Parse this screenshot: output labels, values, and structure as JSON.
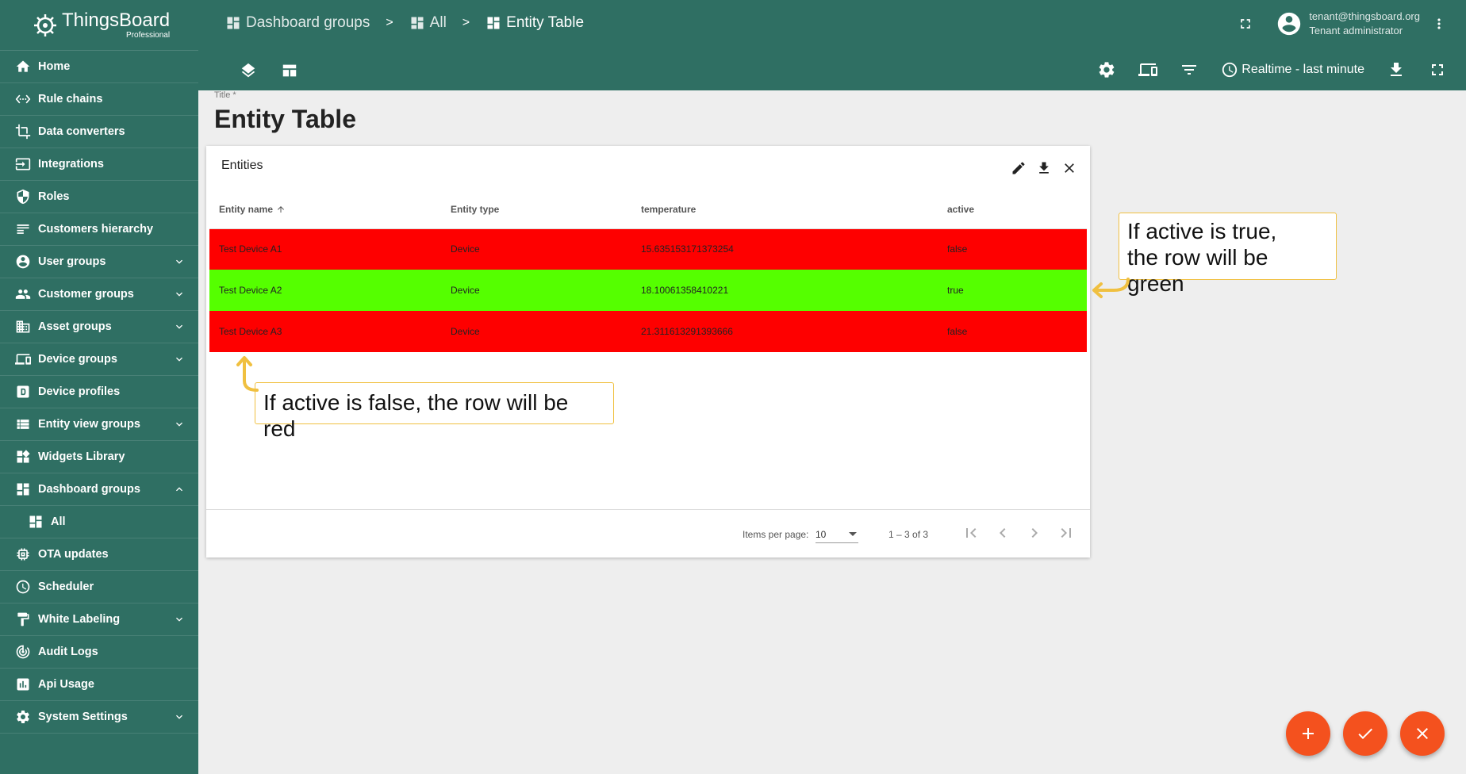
{
  "app": {
    "brand": "ThingsBoard",
    "edition": "Professional"
  },
  "sidebar": {
    "items": [
      {
        "label": "Home",
        "icon": "home-icon"
      },
      {
        "label": "Rule chains",
        "icon": "rule-chains-icon"
      },
      {
        "label": "Data converters",
        "icon": "data-converters-icon"
      },
      {
        "label": "Integrations",
        "icon": "integrations-icon"
      },
      {
        "label": "Roles",
        "icon": "shield-icon"
      },
      {
        "label": "Customers hierarchy",
        "icon": "hierarchy-icon"
      },
      {
        "label": "User groups",
        "icon": "account-icon",
        "expandable": true
      },
      {
        "label": "Customer groups",
        "icon": "people-icon",
        "expandable": true
      },
      {
        "label": "Asset groups",
        "icon": "domain-icon",
        "expandable": true
      },
      {
        "label": "Device groups",
        "icon": "devices-icon",
        "expandable": true
      },
      {
        "label": "Device profiles",
        "icon": "device-profile-icon"
      },
      {
        "label": "Entity view groups",
        "icon": "view-list-icon",
        "expandable": true
      },
      {
        "label": "Widgets Library",
        "icon": "widgets-icon"
      },
      {
        "label": "Dashboard groups",
        "icon": "dashboard-icon",
        "expandable": true,
        "expanded": true
      },
      {
        "label": "All",
        "icon": "dashboard-icon",
        "sub": true
      },
      {
        "label": "OTA updates",
        "icon": "chip-icon"
      },
      {
        "label": "Scheduler",
        "icon": "clock-icon"
      },
      {
        "label": "White Labeling",
        "icon": "paint-roller-icon",
        "expandable": true
      },
      {
        "label": "Audit Logs",
        "icon": "track-changes-icon"
      },
      {
        "label": "Api Usage",
        "icon": "insert-chart-icon"
      },
      {
        "label": "System Settings",
        "icon": "gear-icon",
        "expandable": true
      }
    ]
  },
  "breadcrumb": [
    {
      "label": "Dashboard groups"
    },
    {
      "label": "All"
    },
    {
      "label": "Entity Table"
    }
  ],
  "breadcrumb_separator": ">",
  "user": {
    "email": "tenant@thingsboard.org",
    "role": "Tenant administrator"
  },
  "toolbar": {
    "timewindow": "Realtime - last minute"
  },
  "dashboard": {
    "title_label": "Title *",
    "title": "Entity Table"
  },
  "widget": {
    "title": "Entities",
    "columns": [
      "Entity name",
      "Entity type",
      "temperature",
      "active"
    ],
    "rows": [
      {
        "name": "Test Device A1",
        "type": "Device",
        "temperature": "15.635153171373254",
        "active": "false"
      },
      {
        "name": "Test Device A2",
        "type": "Device",
        "temperature": "18.10061358410221",
        "active": "true"
      },
      {
        "name": "Test Device A3",
        "type": "Device",
        "temperature": "21.311613291393666",
        "active": "false"
      }
    ],
    "paginator": {
      "items_per_page_label": "Items per page:",
      "items_per_page": "10",
      "range": "1 – 3 of 3"
    }
  },
  "annotations": {
    "green_line1": "If active is true,",
    "green_line2": "the row will be green",
    "red": "If active is false, the row will be red"
  },
  "colors": {
    "primary": "#2f6f63",
    "row_false": "#fe0000",
    "row_true": "#55ff00",
    "fab": "#f4511e",
    "callout_border": "#f0c040"
  }
}
